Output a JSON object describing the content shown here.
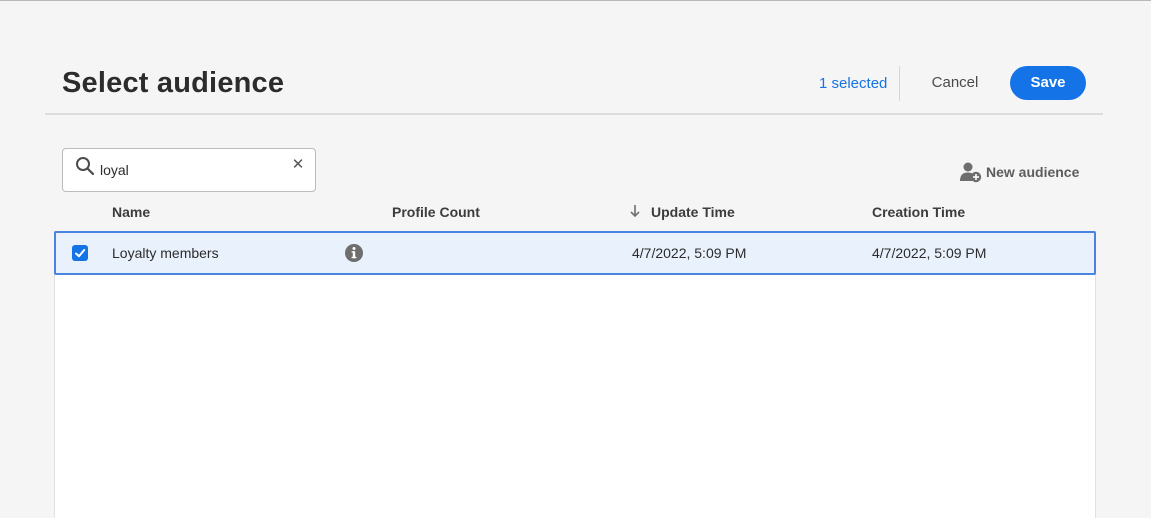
{
  "dialog": {
    "title": "Select audience",
    "selected_count": "1 selected",
    "cancel_label": "Cancel",
    "save_label": "Save"
  },
  "search": {
    "value": "loyal",
    "icon": "search-icon",
    "clear_icon": "close-icon"
  },
  "toolbar": {
    "new_audience_label": "New audience",
    "new_audience_icon": "add-user-icon"
  },
  "table": {
    "columns": [
      "Name",
      "Profile Count",
      "Update Time",
      "Creation Time"
    ],
    "sort_column": "Update Time",
    "sort_direction": "descending",
    "rows": [
      {
        "selected": true,
        "name": "Loyalty members",
        "profile_count": "",
        "update_time": "4/7/2022, 5:09 PM",
        "creation_time": "4/7/2022, 5:09 PM",
        "info_icon": "info-icon"
      }
    ]
  },
  "colors": {
    "accent": "#1473e6",
    "selected_row_bg": "#e9f1fc",
    "selected_row_border": "#4a84e0",
    "background": "#f5f5f5"
  }
}
